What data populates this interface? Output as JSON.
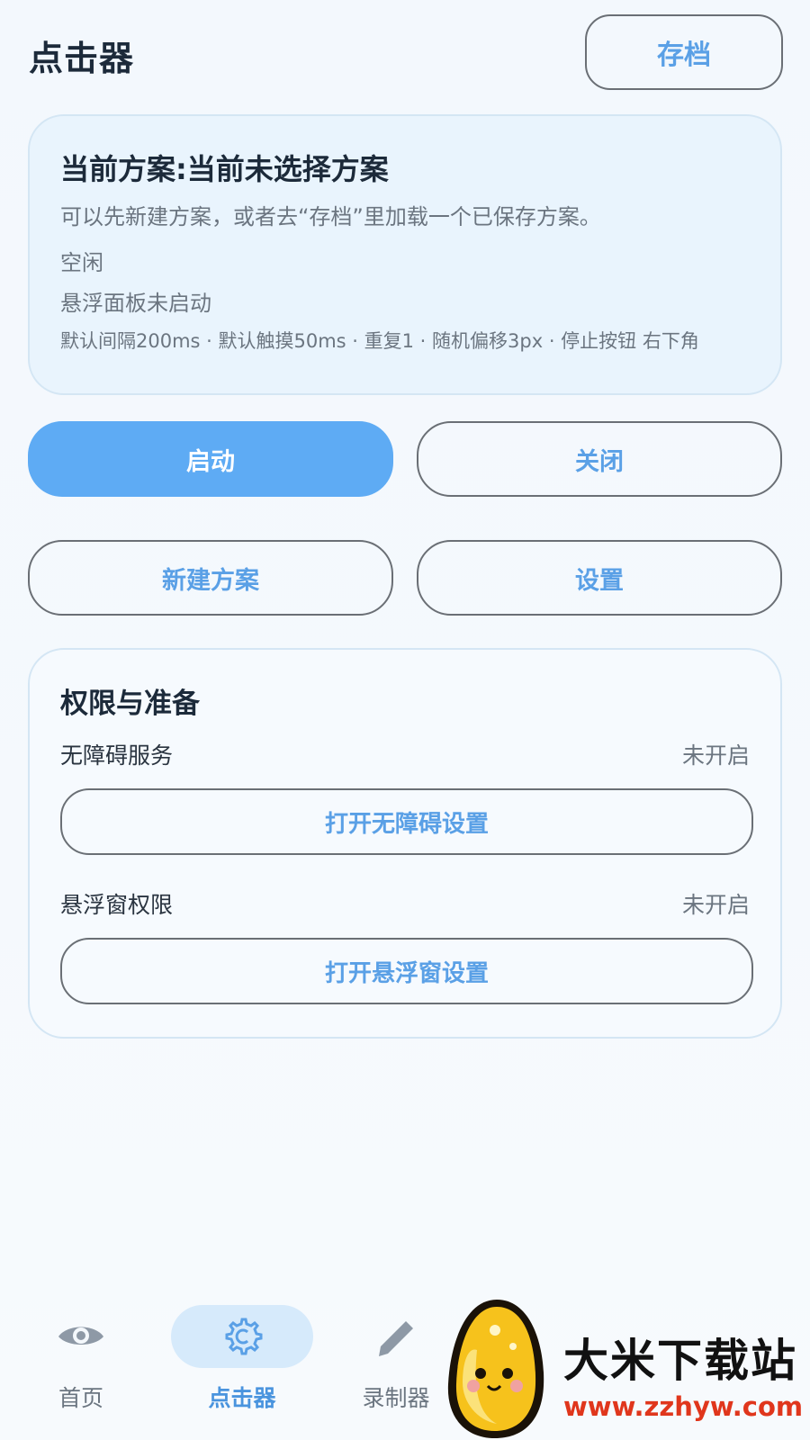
{
  "header": {
    "title": "点击器",
    "archive_label": "存档"
  },
  "plan_card": {
    "title": "当前方案:当前未选择方案",
    "hint": "可以先新建方案，或者去“存档”里加载一个已保存方案。",
    "status": "空闲",
    "overlay_status": "悬浮面板未启动",
    "params": "默认间隔200ms · 默认触摸50ms · 重复1 · 随机偏移3px · 停止按钮 右下角"
  },
  "actions": {
    "start_label": "启动",
    "close_label": "关闭",
    "new_plan_label": "新建方案",
    "settings_label": "设置"
  },
  "permissions": {
    "title": "权限与准备",
    "accessibility": {
      "label": "无障碍服务",
      "state": "未开启",
      "button_label": "打开无障碍设置"
    },
    "overlay": {
      "label": "悬浮窗权限",
      "state": "未开启",
      "button_label": "打开悬浮窗设置"
    }
  },
  "bottom_nav": {
    "items": [
      {
        "label": "首页",
        "icon": "eye-icon",
        "active": false
      },
      {
        "label": "点击器",
        "icon": "gear-icon",
        "active": true
      },
      {
        "label": "录制器",
        "icon": "pencil-icon",
        "active": false
      }
    ]
  },
  "watermark": {
    "name": "大米下载站",
    "url": "www.zzhyw.com"
  },
  "colors": {
    "accent": "#5aa0e6",
    "primary_button": "#5eabf4",
    "card_background": "#e9f4fd",
    "active_nav_bg": "#d6eafb"
  }
}
